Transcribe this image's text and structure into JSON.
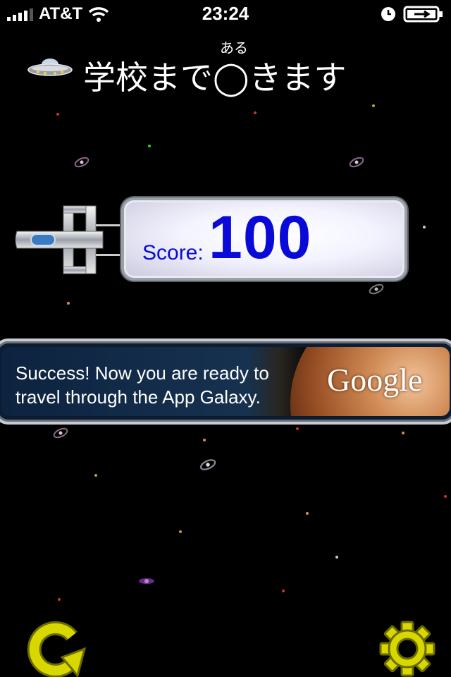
{
  "status_bar": {
    "carrier": "AT&T",
    "time": "23:24",
    "icons": [
      "signal-bars-icon",
      "wifi-icon",
      "clock-icon",
      "battery-charging-icon"
    ]
  },
  "question": {
    "furigana": "ある",
    "text": "学校まで◯きます"
  },
  "score": {
    "label": "Score:",
    "value": "100"
  },
  "ad": {
    "message": "Success! Now you are ready to\ntravel through the App Galaxy.",
    "brand": "Google"
  },
  "controls": {
    "retry_icon": "retry-arrow-icon",
    "settings_icon": "gear-icon"
  },
  "colors": {
    "score_text": "#0a0ad8",
    "button_yellow": "#d8d800",
    "background": "#000000"
  }
}
